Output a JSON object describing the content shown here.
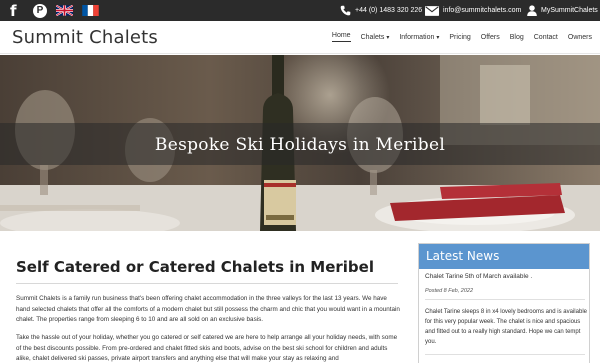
{
  "topbar": {
    "social": [
      {
        "name": "facebook",
        "icon": "facebook-icon",
        "glyph": "f"
      },
      {
        "name": "pinterest",
        "icon": "pinterest-icon",
        "glyph": "P"
      }
    ],
    "languages": [
      "English",
      "Français"
    ],
    "phone": "+44 (0) 1483 320 226",
    "email": "info@summitchalets.com",
    "account": "MySummitChalets"
  },
  "nav": {
    "brand": "Summit Chalets",
    "items": [
      {
        "label": "Home",
        "active": true
      },
      {
        "label": "Chalets",
        "dropdown": true
      },
      {
        "label": "Information",
        "dropdown": true
      },
      {
        "label": "Pricing"
      },
      {
        "label": "Offers"
      },
      {
        "label": "Blog"
      },
      {
        "label": "Contact"
      },
      {
        "label": "Owners"
      }
    ]
  },
  "hero": {
    "title": "Bespoke Ski Holidays in Meribel"
  },
  "main": {
    "heading": "Self Catered or Catered Chalets in Meribel",
    "paragraph1": "Summit Chalets is a family run business that's been offering chalet accommodation in the three valleys for the last 13 years. We have hand selected chalets that offer all the comforts of a modern chalet but still possess the charm and chic that you would want in a mountain chalet. The properties range from sleeping 6 to 10 and are all sold on an exclusive basis.",
    "paragraph2": "Take the hassle out of your holiday, whether you go catered or self catered we are here to help arrange all your holiday needs, with some of the best discounts possible. From pre-ordered and chalet fitted skis and boots, advise on the best ski school for children and adults alike, chalet delivered ski passes, private airport transfers and anything else that will make your stay as relaxing and"
  },
  "sidebar": {
    "heading": "Latest News",
    "post_title": "Chalet Tarine 5th of March available .",
    "post_date": "Posted 8 Feb, 2022",
    "post_body": "Chalet Tarine sleeps 8 in x4 lovely bedrooms and is available for this very popular week. The chalet is nice and spacious and fitted out to a really high standard. Hope we can tempt you."
  },
  "colors": {
    "topbar_bg": "#2b2b2b",
    "news_header": "#5b95cf"
  }
}
